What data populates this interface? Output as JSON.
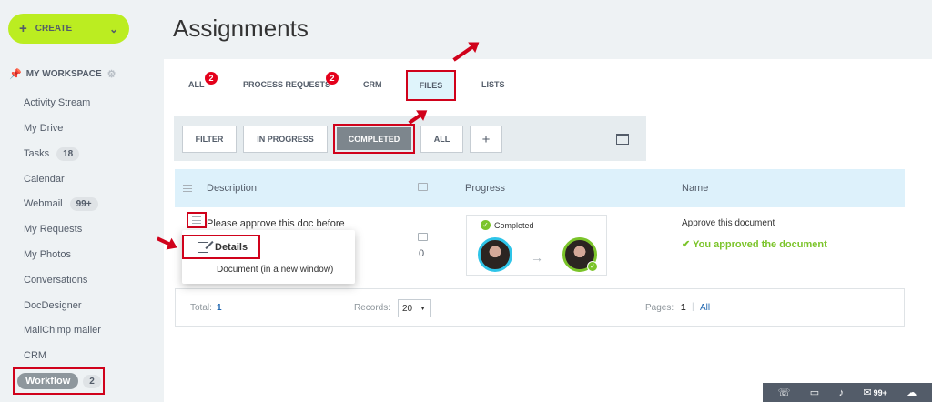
{
  "sidebar": {
    "create_label": "CREATE",
    "workspace_label": "MY WORKSPACE",
    "items": [
      {
        "label": "Activity Stream"
      },
      {
        "label": "My Drive"
      },
      {
        "label": "Tasks",
        "badge": "18"
      },
      {
        "label": "Calendar"
      },
      {
        "label": "Webmail",
        "badge": "99+"
      },
      {
        "label": "My Requests"
      },
      {
        "label": "My Photos"
      },
      {
        "label": "Conversations"
      },
      {
        "label": "DocDesigner"
      },
      {
        "label": "MailChimp mailer"
      },
      {
        "label": "CRM"
      }
    ],
    "workflow": {
      "label": "Workflow",
      "badge": "2"
    }
  },
  "page_title": "Assignments",
  "tabs": [
    {
      "label": "ALL",
      "badge": "2"
    },
    {
      "label": "PROCESS REQUESTS",
      "badge": "2"
    },
    {
      "label": "CRM"
    },
    {
      "label": "FILES"
    },
    {
      "label": "LISTS"
    }
  ],
  "filters": {
    "filter": "FILTER",
    "in_progress": "IN PROGRESS",
    "completed": "COMPLETED",
    "all": "ALL",
    "add": "+"
  },
  "table": {
    "headers": {
      "description": "Description",
      "progress": "Progress",
      "name": "Name"
    },
    "row": {
      "description": "Please approve this doc before",
      "comments": "0",
      "progress_status": "Completed",
      "name_title": "Approve this document",
      "name_status": "You approved the document"
    }
  },
  "context_menu": {
    "details": "Details",
    "document": "Document (in a new window)"
  },
  "footer": {
    "total_label": "Total:",
    "total_value": "1",
    "records_label": "Records:",
    "records_value": "20",
    "pages_label": "Pages:",
    "page_current": "1",
    "page_all": "All"
  },
  "statusbar": {
    "mail_count": "99+"
  }
}
